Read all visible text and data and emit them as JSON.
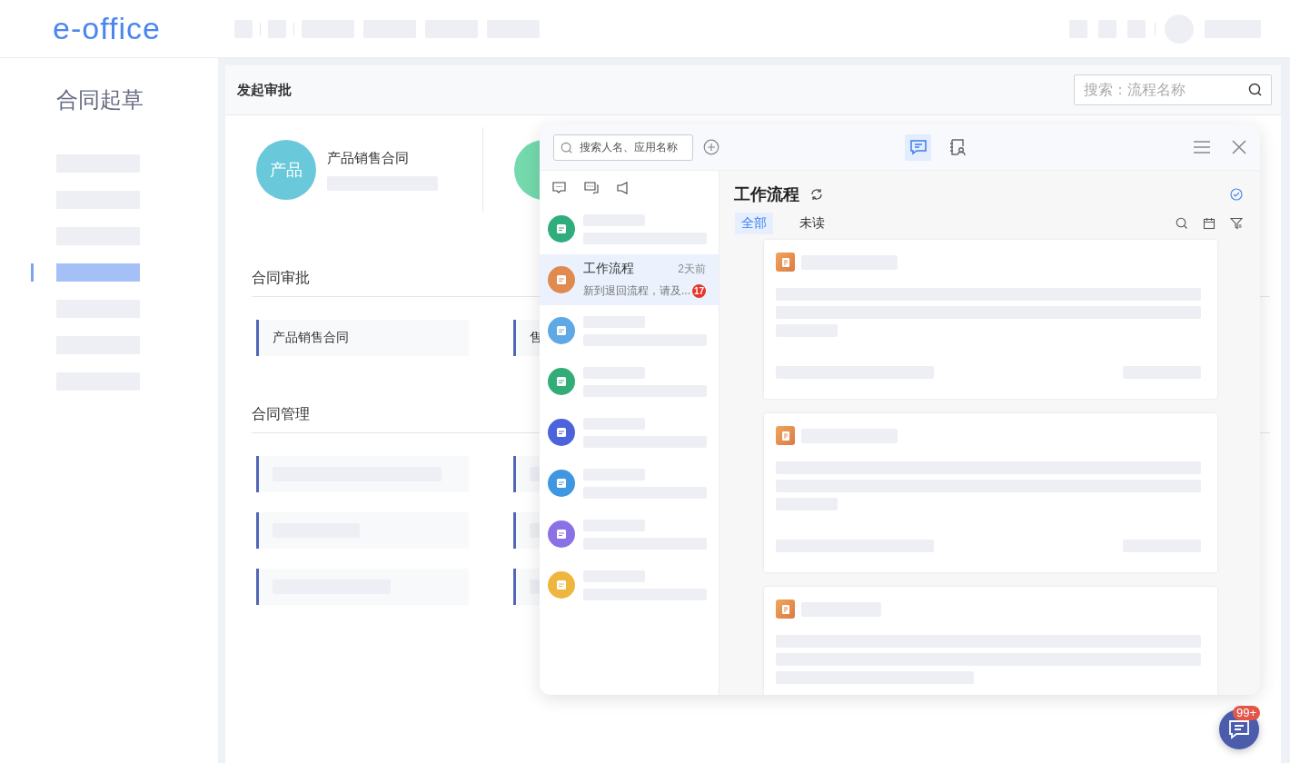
{
  "header": {
    "logo": "e-office"
  },
  "sidebar": {
    "title": "合同起草",
    "items": [
      {
        "selected": false
      },
      {
        "selected": false
      },
      {
        "selected": false
      },
      {
        "selected": true
      },
      {
        "selected": false
      },
      {
        "selected": false
      },
      {
        "selected": false
      }
    ]
  },
  "main": {
    "title": "发起审批",
    "search": {
      "placeholder": "搜索：流程名称"
    },
    "featured": [
      {
        "avatar": "产品",
        "color": "#69c9da",
        "name": "产品销售合同"
      },
      {
        "color": "#74d9ac"
      }
    ],
    "sections": [
      {
        "title": "合同审批",
        "items": [
          {
            "kind": "text",
            "label": "产品销售合同"
          },
          {
            "kind": "text",
            "label": "售"
          }
        ]
      },
      {
        "title": "合同管理",
        "items": [
          {
            "kind": "placeholder"
          },
          {
            "kind": "placeholder"
          },
          {
            "kind": "placeholder"
          },
          {
            "kind": "placeholder"
          },
          {
            "kind": "placeholder"
          },
          {
            "kind": "placeholder"
          }
        ]
      }
    ]
  },
  "messenger": {
    "search": {
      "placeholder": "搜索人名、应用名称"
    },
    "view_tabs": [
      {
        "selected": true
      },
      {
        "selected": false
      }
    ],
    "conversations": [
      {
        "kind": "placeholder",
        "color": "#30ad7d",
        "selected": false
      },
      {
        "kind": "chat",
        "color": "#e08a4f",
        "name": "工作流程",
        "time": "2天前",
        "preview": "新到退回流程，请及...",
        "unread": "17",
        "selected": true
      },
      {
        "kind": "placeholder",
        "color": "#5fa8e6",
        "selected": false
      },
      {
        "kind": "placeholder",
        "color": "#32ad77",
        "selected": false
      },
      {
        "kind": "placeholder",
        "color": "#4c63dc",
        "selected": false
      },
      {
        "kind": "placeholder",
        "color": "#3f97e2",
        "selected": false
      },
      {
        "kind": "placeholder",
        "color": "#8a72e6",
        "selected": false
      },
      {
        "kind": "placeholder",
        "color": "#efb63f",
        "selected": false
      }
    ],
    "detail": {
      "title": "工作流程",
      "tabs": [
        {
          "label": "全部",
          "selected": true
        },
        {
          "label": "未读",
          "selected": false
        }
      ]
    }
  },
  "chat_button": {
    "badge": "99+"
  }
}
